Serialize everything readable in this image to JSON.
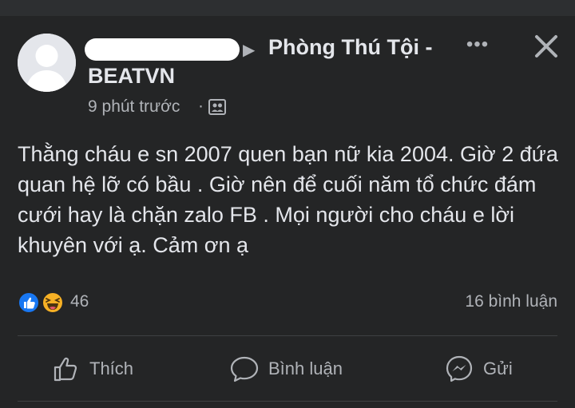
{
  "post": {
    "group_name_line1": "Phòng Thú Tội -",
    "group_name_line2": "BEATVN",
    "separator_arrow": "▶",
    "timestamp": "9 phút trước",
    "dot": "·",
    "more_glyph": "•••",
    "body": "Thằng cháu e sn 2007 quen bạn nữ kia 2004. Giờ 2 đứa quan hệ lỡ có bầu . Giờ nên để cuối năm tổ chức đám cưới hay là chặn zalo FB . Mọi người cho cháu e lời khuyên với ạ. Cảm ơn ạ"
  },
  "engagement": {
    "reaction_count": "46",
    "comment_count": "16 bình luận",
    "reaction_icons": [
      "like-reaction-icon",
      "haha-reaction-icon"
    ]
  },
  "actions": {
    "like_label": "Thích",
    "comment_label": "Bình luận",
    "share_label": "Gửi"
  },
  "colors": {
    "card_bg": "#242526",
    "text": "#e4e6eb",
    "secondary_text": "#b0b3b8",
    "like_blue": "#1877f2",
    "haha_yellow": "#f7b125"
  }
}
